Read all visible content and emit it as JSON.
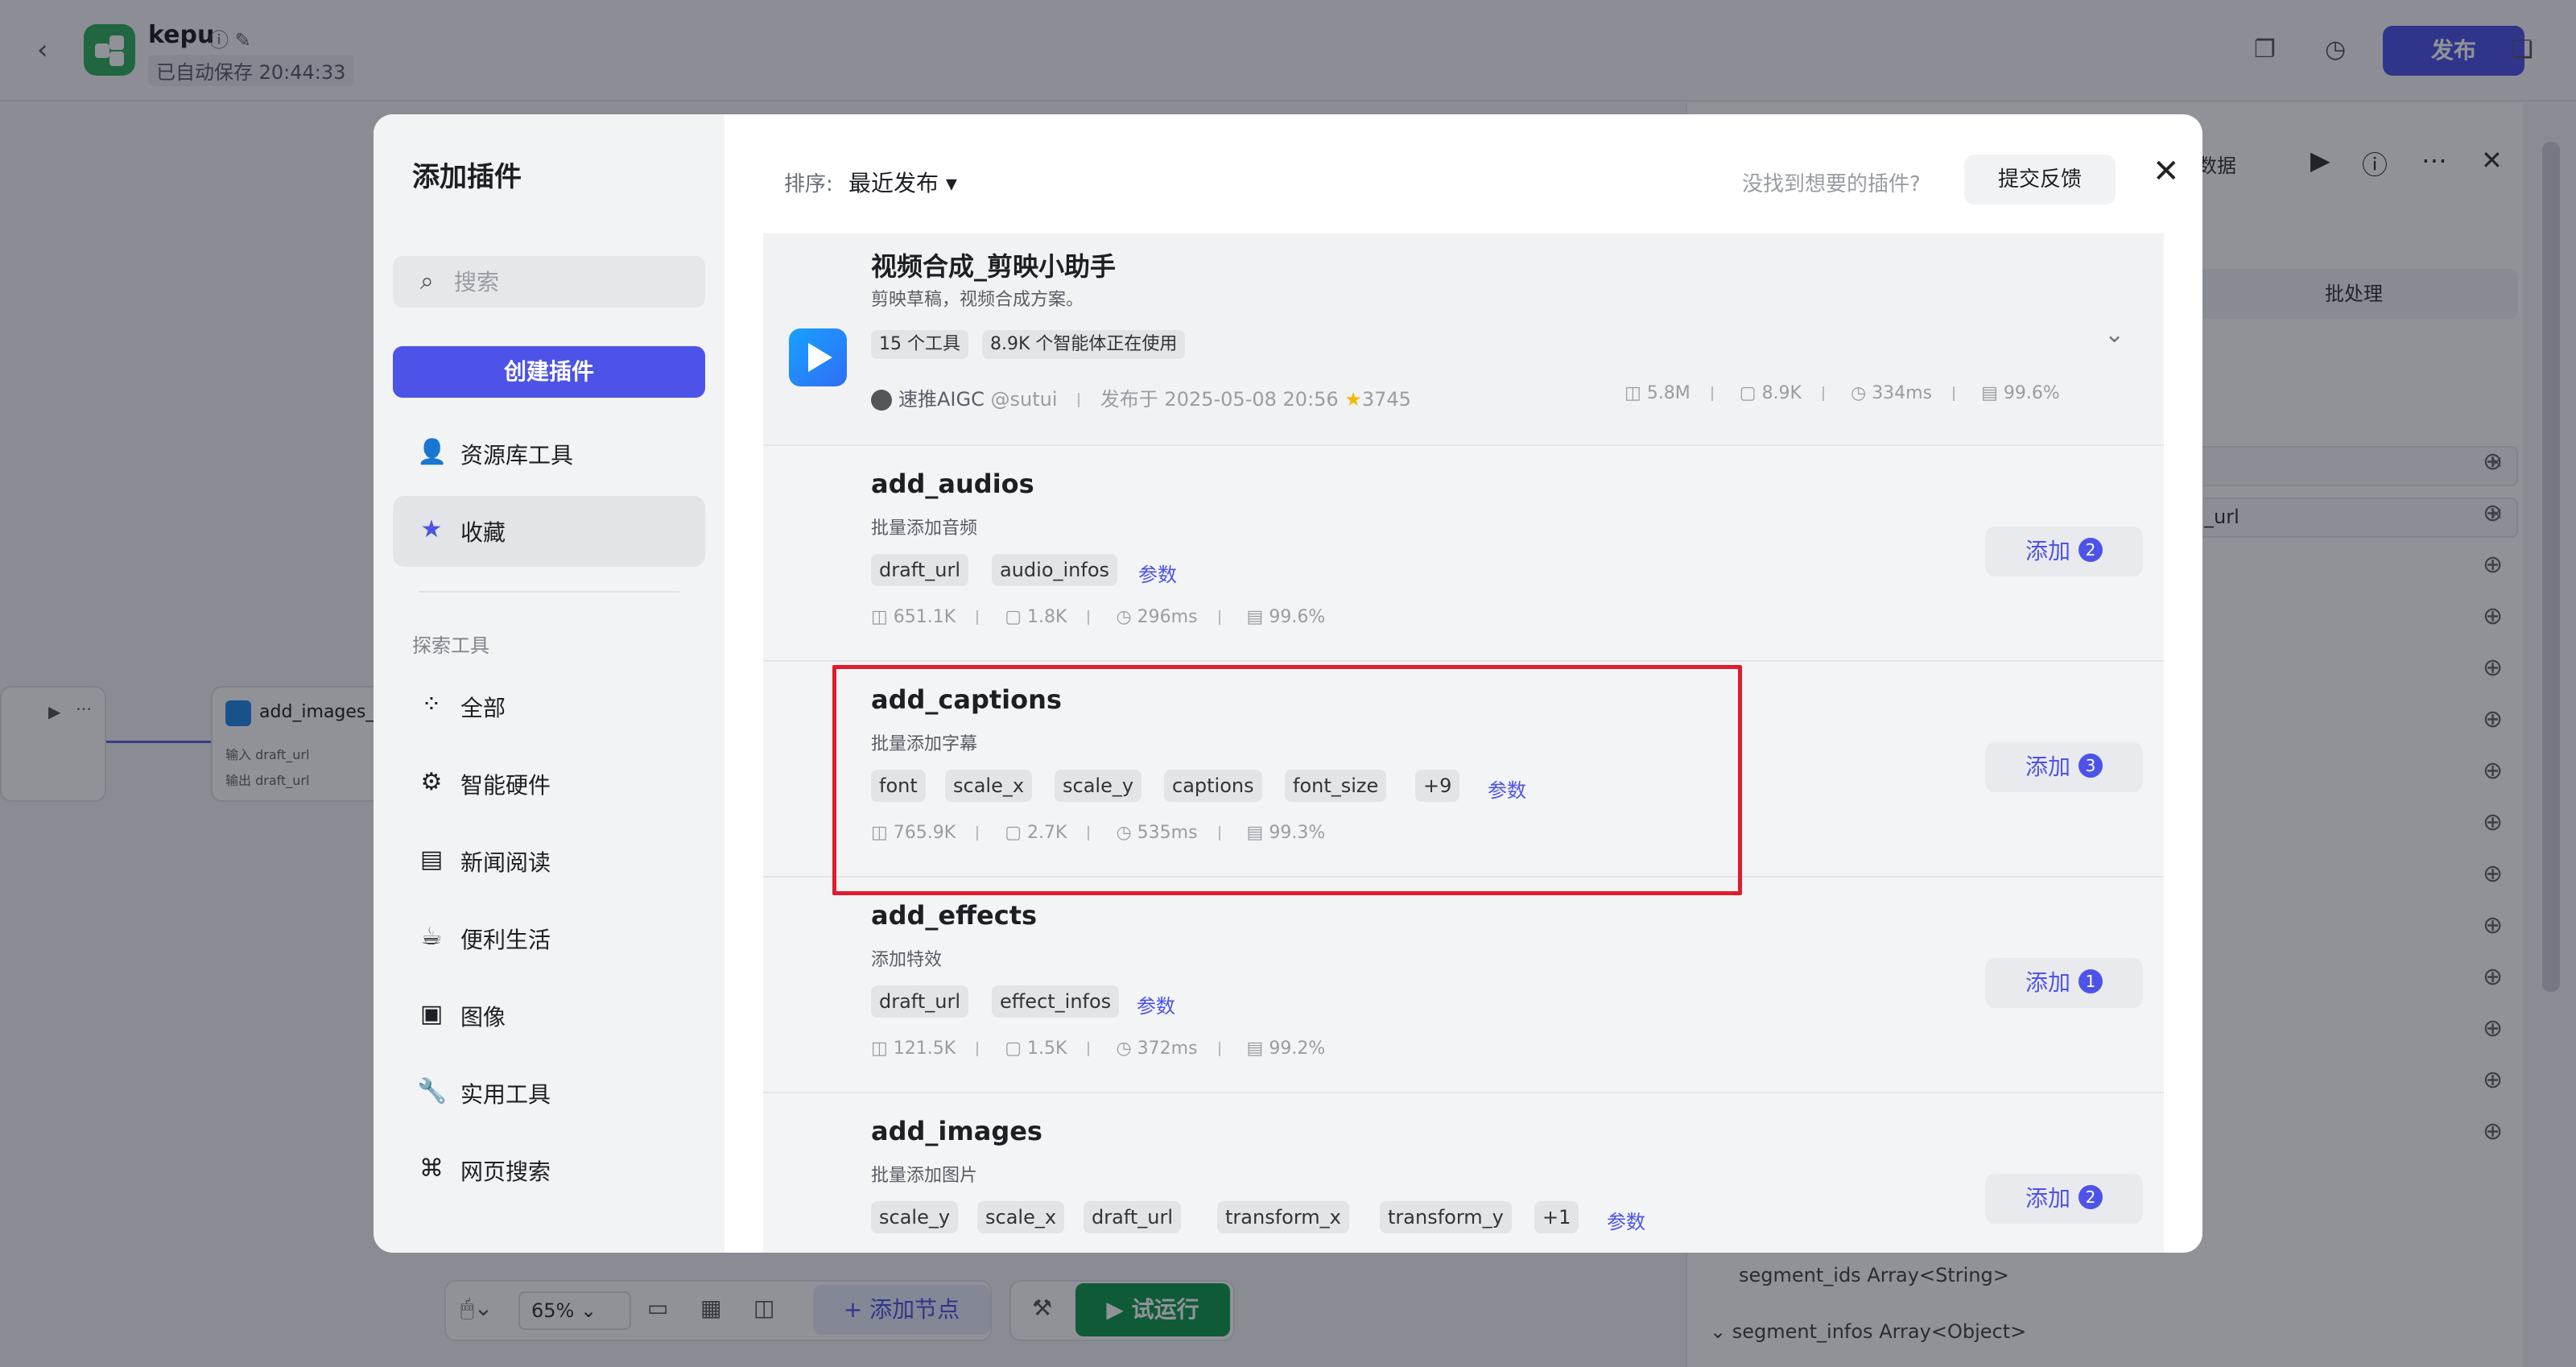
{
  "app": {
    "name": "kepu",
    "save_status": "已自动保存 20:44:33",
    "publish_label": "发布",
    "colors": {
      "accent": "#4d53e8",
      "highlight": "#e01c2c",
      "run": "#0f9a4e"
    }
  },
  "canvas": {
    "node_title": "add_images_",
    "node_inputs": [
      "draft_url",
      "draft_url"
    ],
    "node_row_labels": [
      "输入",
      "输出"
    ],
    "zoom_value": "65%",
    "add_node_label": "添加节点",
    "test_run_label": "试运行"
  },
  "right_panel": {
    "header_label": "数据",
    "batch_label": "批处理",
    "row_text": "_url",
    "fields": [
      {
        "name": "segment_ids",
        "type": "Array<String>"
      },
      {
        "name": "segment_infos",
        "type": "Array<Object>"
      }
    ]
  },
  "modal": {
    "title": "添加插件",
    "search_placeholder": "搜索",
    "create_label": "创建插件",
    "nav_main": [
      {
        "label": "资源库工具",
        "icon": "person-icon"
      },
      {
        "label": "收藏",
        "icon": "star-icon"
      }
    ],
    "section_label": "探索工具",
    "nav_explore": [
      {
        "label": "全部",
        "icon": "grid-icon"
      },
      {
        "label": "智能硬件",
        "icon": "chip-icon"
      },
      {
        "label": "新闻阅读",
        "icon": "book-icon"
      },
      {
        "label": "便利生活",
        "icon": "cup-icon"
      },
      {
        "label": "图像",
        "icon": "image-icon"
      },
      {
        "label": "实用工具",
        "icon": "wrench-icon"
      },
      {
        "label": "网页搜索",
        "icon": "network-icon"
      }
    ],
    "sort_label": "排序:",
    "sort_value": "最近发布",
    "hint": "没找到想要的插件?",
    "feedback_label": "提交反馈",
    "plugin": {
      "title": "视频合成_剪映小助手",
      "desc": "剪映草稿，视频合成方案。",
      "tags": [
        "15 个工具",
        "8.9K 个智能体正在使用"
      ],
      "author": "速推AIGC",
      "handle": "@sutui",
      "published": "发布于 2025-05-08 20:56",
      "stars": "3745",
      "stats": [
        "5.8M",
        "8.9K",
        "334ms",
        "99.6%"
      ]
    },
    "params_label": "参数",
    "add_label": "添加",
    "tools": [
      {
        "name": "add_audios",
        "desc": "批量添加音频",
        "params": [
          "draft_url",
          "audio_infos"
        ],
        "stats": [
          "651.1K",
          "1.8K",
          "296ms",
          "99.6%"
        ],
        "count": "2"
      },
      {
        "name": "add_captions",
        "desc": "批量添加字幕",
        "params": [
          "font",
          "scale_x",
          "scale_y",
          "captions",
          "font_size",
          "+9"
        ],
        "stats": [
          "765.9K",
          "2.7K",
          "535ms",
          "99.3%"
        ],
        "count": "3"
      },
      {
        "name": "add_effects",
        "desc": "添加特效",
        "params": [
          "draft_url",
          "effect_infos"
        ],
        "stats": [
          "121.5K",
          "1.5K",
          "372ms",
          "99.2%"
        ],
        "count": "1"
      },
      {
        "name": "add_images",
        "desc": "批量添加图片",
        "params": [
          "scale_y",
          "scale_x",
          "draft_url",
          "transform_x",
          "transform_y",
          "+1"
        ],
        "count": "2"
      }
    ]
  }
}
